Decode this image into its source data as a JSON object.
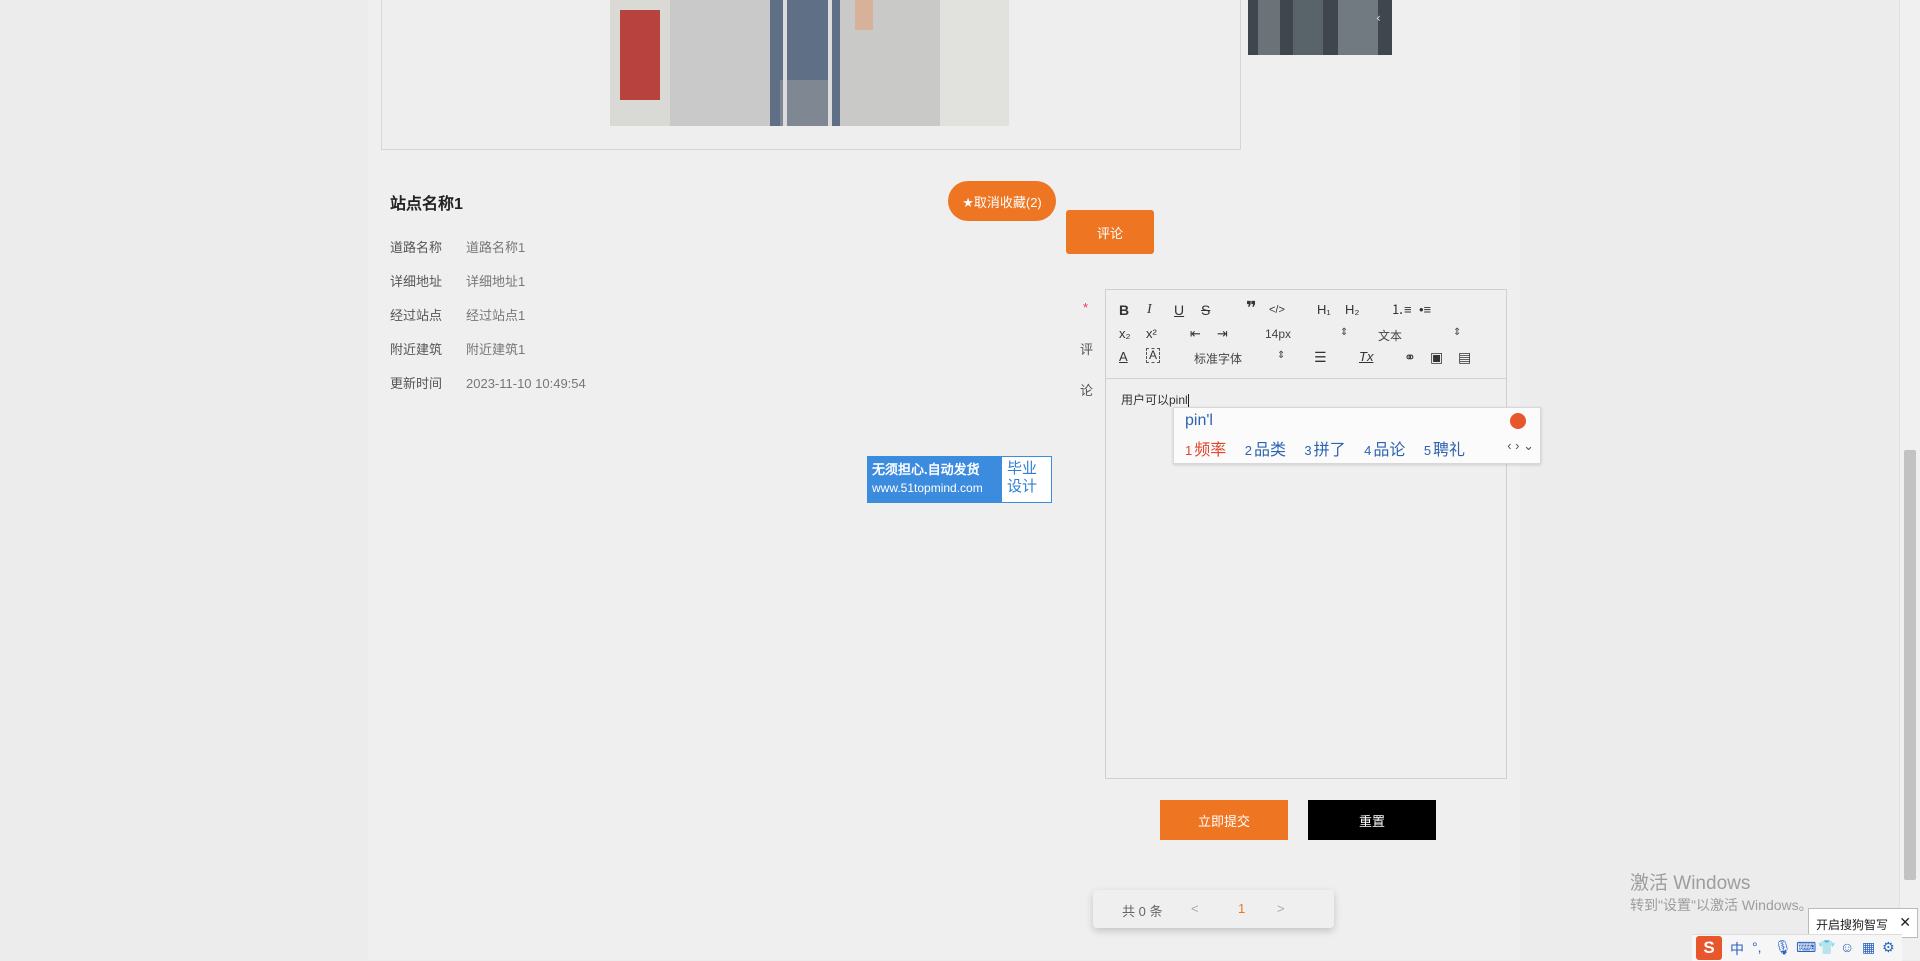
{
  "station": {
    "title": "站点名称1",
    "rows": [
      {
        "label": "道路名称",
        "value": "道路名称1"
      },
      {
        "label": "详细地址",
        "value": "详细地址1"
      },
      {
        "label": "经过站点",
        "value": "经过站点1"
      },
      {
        "label": "附近建筑",
        "value": "附近建筑1"
      },
      {
        "label": "更新时间",
        "value": "2023-11-10 10:49:54"
      }
    ],
    "favorite_label": "★取消收藏(2)",
    "comment_label": "评论"
  },
  "comment_form": {
    "required_mark": "*",
    "label_top": "评",
    "label_bottom": "论",
    "toolbar": {
      "font_size": "14px",
      "paragraph": "文本",
      "font_family": "标准字体"
    },
    "content": "用户可以pinl",
    "submit_label": "立即提交",
    "reset_label": "重置"
  },
  "ime": {
    "input": "pin'l",
    "candidates": [
      {
        "num": "1",
        "text": "频率"
      },
      {
        "num": "2",
        "text": "品类"
      },
      {
        "num": "3",
        "text": "拼了"
      },
      {
        "num": "4",
        "text": "品论"
      },
      {
        "num": "5",
        "text": "聘礼"
      }
    ]
  },
  "ad": {
    "line1": "无须担心.自动发货",
    "url": "www.51topmind.com",
    "right1": "毕业",
    "right2": "设计"
  },
  "pager": {
    "total": "共 0 条",
    "prev": "<",
    "page": "1",
    "next": ">"
  },
  "os": {
    "activate_title": "激活 Windows",
    "activate_sub": "转到\"设置\"以激活 Windows。",
    "sogou_tip": "开启搜狗智写",
    "ime_mode": "中"
  },
  "colors": {
    "accent": "#ee7623",
    "reset": "#000000",
    "ime_blue": "#2c64b0"
  }
}
